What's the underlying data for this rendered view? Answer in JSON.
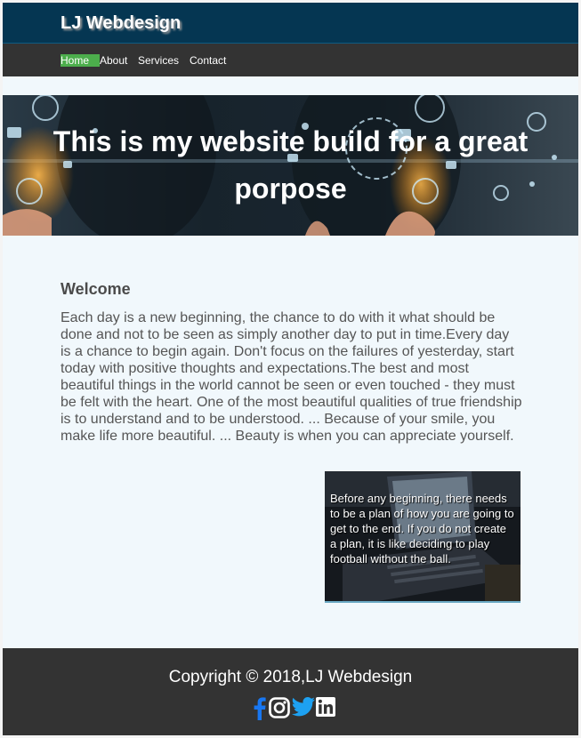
{
  "header": {
    "brand": "LJ Webdesign"
  },
  "nav": {
    "items": [
      {
        "label": "Home",
        "active": true
      },
      {
        "label": "About"
      },
      {
        "label": "Services"
      },
      {
        "label": "Contact"
      }
    ],
    "active_color": "#4cae4c"
  },
  "hero": {
    "title": "This is my website build for a great porpose"
  },
  "welcome": {
    "title": "Welcome",
    "text": "Each day is a new beginning, the chance to do with it what should be done and not to be seen as simply another day to put in time.Every day is a chance to begin again. Don't focus on the failures of yesterday, start today with positive thoughts and expectations.The best and most beautiful things in the world cannot be seen or even touched - they must be felt with the heart. One of the most beautiful qualities of true friendship is to understand and to be understood. ... Because of your smile, you make life more beautiful. ... Beauty is when you can appreciate yourself."
  },
  "card": {
    "text": "Before any beginning, there needs to be a plan of how you are going to get to the end. If you do not create a plan, it is like deciding to play football without the ball."
  },
  "footer": {
    "copyright": "Copyright © 2018,LJ Webdesign",
    "socials": [
      "facebook-icon",
      "instagram-icon",
      "twitter-icon",
      "linkedin-icon"
    ]
  },
  "colors": {
    "topbar": "#053652",
    "navbar": "#333333",
    "footer": "#333333",
    "content_bg": "#f1f8fc",
    "facebook": "#1877f2",
    "twitter": "#1da1f2"
  }
}
